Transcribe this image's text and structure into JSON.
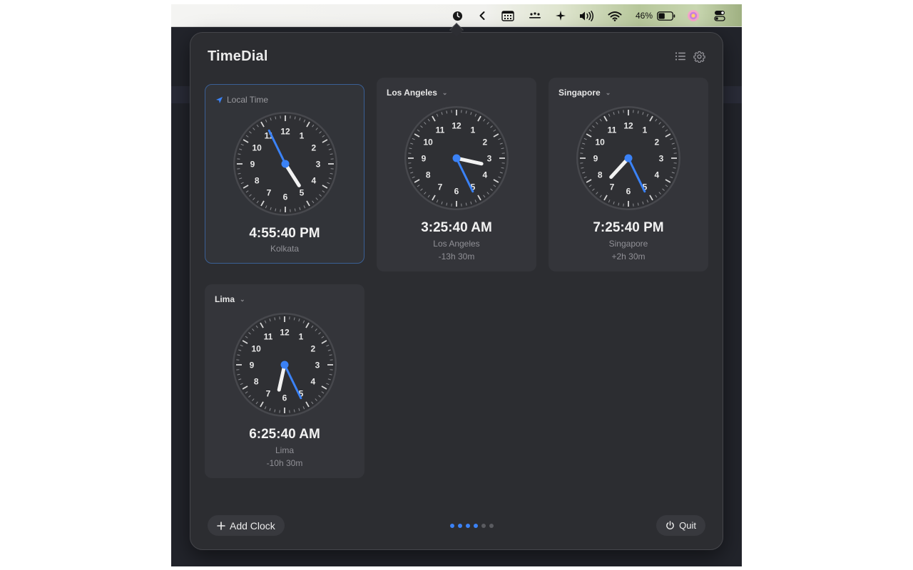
{
  "menubar": {
    "battery_percent": "46%",
    "battery_level": 0.46,
    "icons": [
      "clock-icon",
      "chevron-left-icon",
      "calendar-icon",
      "crowd-icon",
      "sparkle-icon",
      "volume-icon",
      "wifi-icon",
      "battery-icon",
      "color-wheel-icon",
      "control-center-icon"
    ]
  },
  "app": {
    "title": "TimeDial",
    "add_clock_label": "Add Clock",
    "quit_label": "Quit"
  },
  "pager": {
    "total": 6,
    "active": 4
  },
  "colors": {
    "accent": "#3b82f6",
    "panel": "#2c2d31",
    "card": "#34353a",
    "hour_hand": "#f2f2f2",
    "minute_hand": "#3b82f6"
  },
  "clocks": [
    {
      "label": "Local Time",
      "is_local": true,
      "time": "4:55:40 PM",
      "city": "Kolkata",
      "offset": "",
      "hour": 4,
      "minute": 55,
      "second": 40
    },
    {
      "label": "Los Angeles",
      "is_local": false,
      "time": "3:25:40 AM",
      "city": "Los Angeles",
      "offset": "-13h 30m",
      "hour": 3,
      "minute": 25,
      "second": 40
    },
    {
      "label": "Singapore",
      "is_local": false,
      "time": "7:25:40 PM",
      "city": "Singapore",
      "offset": "+2h 30m",
      "hour": 7,
      "minute": 25,
      "second": 40
    },
    {
      "label": "Lima",
      "is_local": false,
      "time": "6:25:40 AM",
      "city": "Lima",
      "offset": "-10h 30m",
      "hour": 6,
      "minute": 25,
      "second": 40
    }
  ]
}
